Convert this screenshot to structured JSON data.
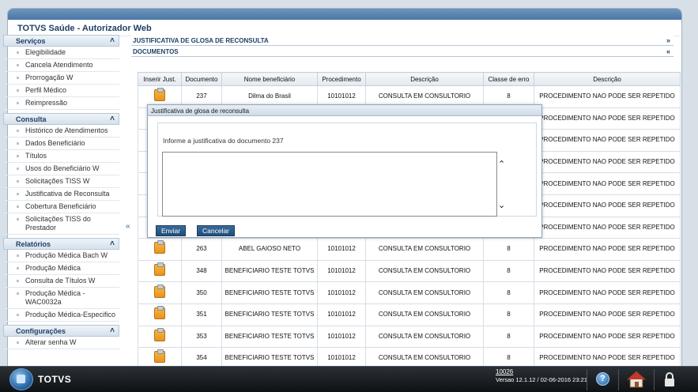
{
  "app": {
    "title": "TOTVS Saúde - Autorizador Web"
  },
  "sidebar": {
    "groups": [
      {
        "title": "Serviços",
        "items": [
          "Elegibilidade",
          "Cancela Atendimento",
          "Prorrogação W",
          "Perfil Médico",
          "Reimpressão"
        ]
      },
      {
        "title": "Consulta",
        "items": [
          "Histórico de Atendimentos",
          "Dados Beneficiário",
          "Títulos",
          "Usos do Beneficiário W",
          "Solicitações TISS W",
          "Justificativa de Reconsulta",
          "Cobertura Beneficiário",
          "Solicitações TISS do Prestador"
        ]
      },
      {
        "title": "Relatórios",
        "items": [
          "Produção Médica Bach W",
          "Produção Médica",
          "Consulta de Títulos W",
          "Produção Médica - WAC0032a",
          "Produção Médica-Especifico"
        ]
      },
      {
        "title": "Configurações",
        "items": [
          "Alterar senha W"
        ]
      }
    ],
    "collapse_glyph": "«"
  },
  "main": {
    "section1": {
      "label": "JUSTIFICATIVA DE GLOSA DE RECONSULTA",
      "arrow": "»"
    },
    "section2": {
      "label": "DOCUMENTOS",
      "arrow": "«"
    },
    "columns": [
      "Inserir Just.",
      "Documento",
      "Nome beneficiário",
      "Procedimento",
      "Descrição",
      "Classe de erro",
      "Descrição"
    ],
    "rows": [
      [
        "237",
        "Dilma do Brasil",
        "10101012",
        "CONSULTA EM CONSULTORIO",
        "8",
        "PROCEDIMENTO NAO PODE SER REPETIDO"
      ],
      [
        "",
        "",
        "",
        "",
        "",
        "PROCEDIMENTO NAO PODE SER REPETIDO"
      ],
      [
        "",
        "",
        "",
        "",
        "",
        "PROCEDIMENTO NAO PODE SER REPETIDO"
      ],
      [
        "",
        "",
        "",
        "",
        "",
        "PROCEDIMENTO NAO PODE SER REPETIDO"
      ],
      [
        "",
        "",
        "",
        "",
        "",
        "PROCEDIMENTO NAO PODE SER REPETIDO"
      ],
      [
        "",
        "",
        "",
        "",
        "",
        "PROCEDIMENTO NAO PODE SER REPETIDO"
      ],
      [
        "",
        "",
        "",
        "",
        "",
        "PROCEDIMENTO NAO PODE SER REPETIDO"
      ],
      [
        "263",
        "ABEL GAIOSO NETO",
        "10101012",
        "CONSULTA EM CONSULTORIO",
        "8",
        "PROCEDIMENTO NAO PODE SER REPETIDO"
      ],
      [
        "348",
        "BENEFICIARIO TESTE TOTVS",
        "10101012",
        "CONSULTA EM CONSULTORIO",
        "8",
        "PROCEDIMENTO NAO PODE SER REPETIDO"
      ],
      [
        "350",
        "BENEFICIARIO TESTE TOTVS",
        "10101012",
        "CONSULTA EM CONSULTORIO",
        "8",
        "PROCEDIMENTO NAO PODE SER REPETIDO"
      ],
      [
        "351",
        "BENEFICIARIO TESTE TOTVS",
        "10101012",
        "CONSULTA EM CONSULTORIO",
        "8",
        "PROCEDIMENTO NAO PODE SER REPETIDO"
      ],
      [
        "353",
        "BENEFICIARIO TESTE TOTVS",
        "10101012",
        "CONSULTA EM CONSULTORIO",
        "8",
        "PROCEDIMENTO NAO PODE SER REPETIDO"
      ],
      [
        "354",
        "BENEFICIARIO TESTE TOTVS",
        "10101012",
        "CONSULTA EM CONSULTORIO",
        "8",
        "PROCEDIMENTO NAO PODE SER REPETIDO"
      ]
    ],
    "row_icon": "clipboard-icon"
  },
  "modal": {
    "title": "Justificativa de glosa de reconsulta",
    "prompt": "Informe a justificativa do documento 237",
    "textarea_value": "",
    "send_label": "Enviar",
    "cancel_label": "Cancelar"
  },
  "taskbar": {
    "brand": "TOTVS",
    "version_id": "10026",
    "version_line": "Versao 12.1.12 / 02-06-2016 23:21",
    "help_glyph": "?"
  },
  "colors": {
    "accent": "#1f4e7c",
    "header_blue": "#4b76a4",
    "title_text": "#1f3f66"
  }
}
